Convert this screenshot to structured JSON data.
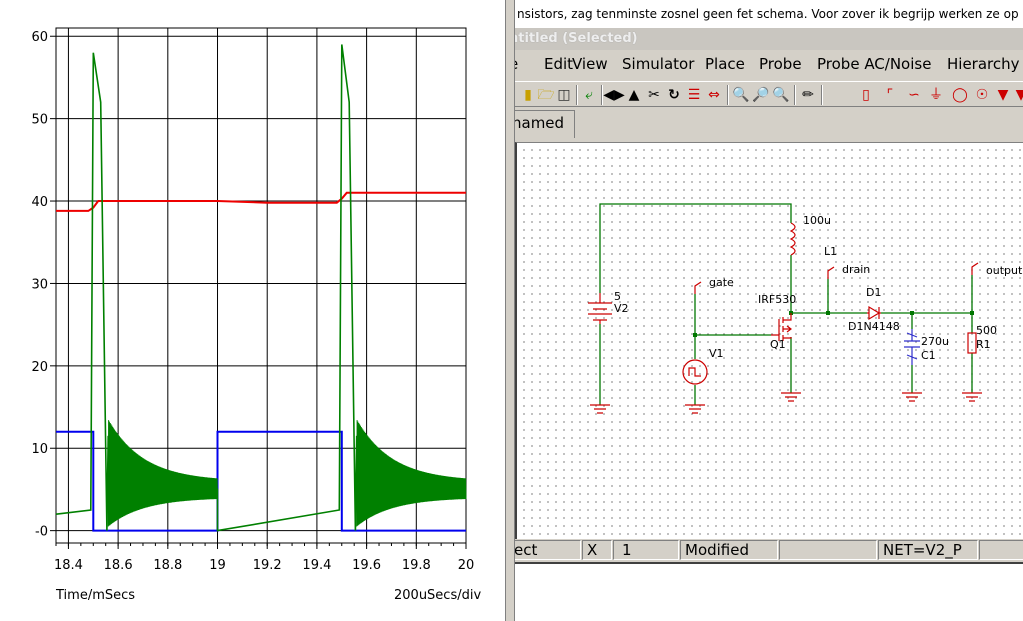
{
  "plot": {
    "x_axis_label": "Time/mSecs",
    "div_label": "200uSecs/div",
    "x_ticks": [
      "18.4",
      "18.6",
      "18.8",
      "19",
      "19.2",
      "19.4",
      "19.6",
      "19.8",
      "20"
    ],
    "y_ticks": [
      "60",
      "50",
      "40",
      "30",
      "20",
      "10",
      "-0"
    ]
  },
  "chart_data": {
    "type": "line",
    "xlabel": "Time/mSecs",
    "xlim": [
      18.35,
      20.0
    ],
    "ylim": [
      -1.5,
      61
    ],
    "grid": true,
    "series": [
      {
        "color": "#ee0000",
        "points": [
          [
            18.35,
            38.8
          ],
          [
            18.48,
            38.8
          ],
          [
            18.5,
            39.2
          ],
          [
            18.52,
            40.0
          ],
          [
            19.0,
            40.0
          ],
          [
            19.2,
            39.8
          ],
          [
            19.48,
            39.8
          ],
          [
            19.5,
            40.3
          ],
          [
            19.52,
            41.0
          ],
          [
            20.0,
            41.0
          ]
        ]
      },
      {
        "color": "#0000ee",
        "points": [
          [
            18.35,
            12
          ],
          [
            18.5,
            12
          ],
          [
            18.5,
            0
          ],
          [
            19.0,
            0
          ],
          [
            19.0,
            12
          ],
          [
            19.5,
            12
          ],
          [
            19.5,
            0
          ],
          [
            20.0,
            0
          ]
        ]
      },
      {
        "color": "#008000",
        "envelope": [
          [
            18.35,
            2
          ],
          [
            18.49,
            2.5
          ],
          [
            18.5,
            58
          ],
          [
            18.53,
            52
          ],
          [
            18.555,
            0
          ],
          [
            18.56,
            11.5
          ],
          [
            18.6,
            8
          ],
          [
            18.7,
            7
          ],
          [
            18.8,
            6
          ],
          [
            19.0,
            5
          ],
          [
            19.0,
            0
          ],
          [
            19.49,
            2.5
          ],
          [
            19.5,
            59
          ],
          [
            19.53,
            52
          ],
          [
            19.555,
            0
          ],
          [
            19.56,
            11.5
          ],
          [
            19.6,
            8
          ],
          [
            19.7,
            6.5
          ],
          [
            19.8,
            6
          ],
          [
            20.0,
            5.5
          ]
        ]
      }
    ]
  },
  "app": {
    "hint_text": "nsistors, zag tenminste zosnel geen fet schema. Voor zover ik begrijp werken ze op een",
    "window_title": "ntitled (Selected)",
    "menu": {
      "partial": "e",
      "edit": "Edit",
      "view": "View",
      "simulator": "Simulator",
      "place": "Place",
      "probe": "Probe",
      "probe_ac": "Probe AC/Noise",
      "hierarchy": "Hierarchy"
    },
    "tab": "named",
    "status": {
      "cell1": "ect",
      "cell2": "X",
      "cell3": "1",
      "cell4": "Modified",
      "cell5": "",
      "cell6": "NET=V2_P"
    }
  },
  "schematic": {
    "labels": {
      "v2_value": "5",
      "v2_name": "V2",
      "gate_probe": "gate",
      "v1_name": "V1",
      "l1_value": "100u",
      "l1_name": "L1",
      "drain_probe": "drain",
      "q1_model": "IRF530",
      "q1_name": "Q1",
      "d1_name": "D1",
      "d1_model": "D1N4148",
      "c1_value": "270u",
      "c1_name": "C1",
      "output_probe": "output",
      "r1_value": "500",
      "r1_name": "R1"
    }
  }
}
